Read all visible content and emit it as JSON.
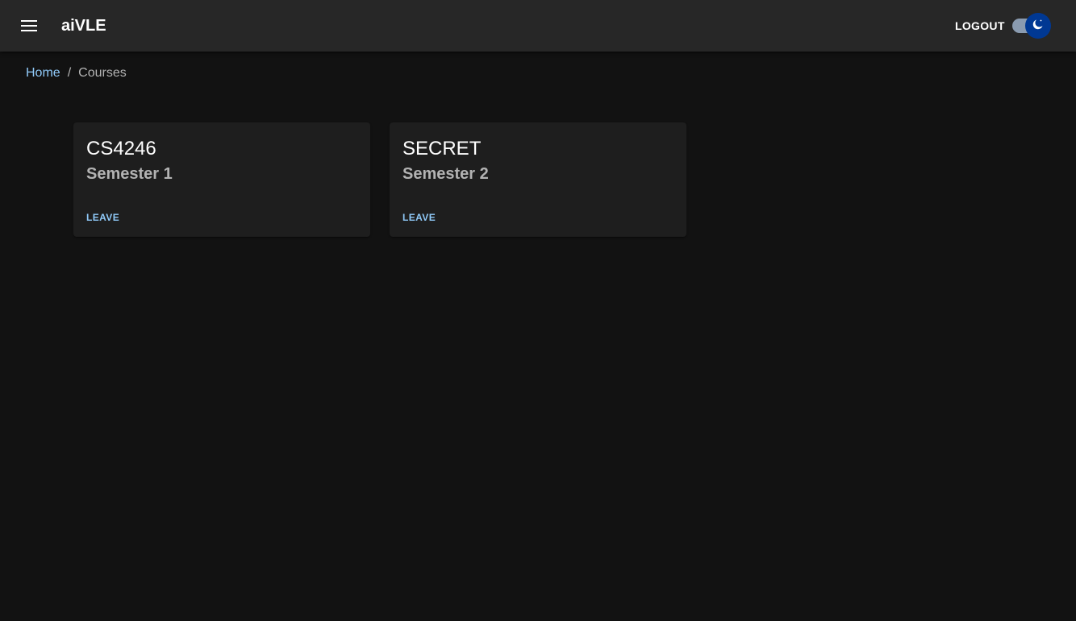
{
  "appbar": {
    "menu_icon": "menu-icon",
    "title": "aiVLE",
    "logout_label": "LOGOUT",
    "theme_toggle": {
      "icon": "moon-icon",
      "state": "dark",
      "track_color": "#8a9bb0",
      "thumb_color": "#003893"
    },
    "background": "#272727"
  },
  "breadcrumb": {
    "home": "Home",
    "separator": "/",
    "current": "Courses"
  },
  "courses": [
    {
      "code": "CS4246",
      "semester": "Semester 1",
      "action": "LEAVE"
    },
    {
      "code": "SECRET",
      "semester": "Semester 2",
      "action": "LEAVE"
    }
  ],
  "colors": {
    "page_background": "#121212",
    "card_background": "#1e1e1e",
    "accent": "#90caf9",
    "secondary_text": "#b3b3b3"
  }
}
